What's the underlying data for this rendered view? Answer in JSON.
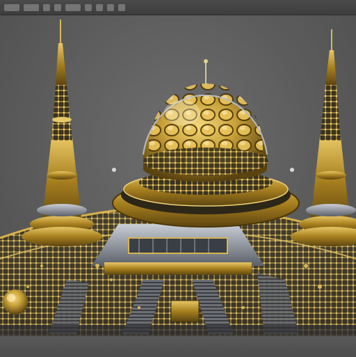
{
  "toolbar": {
    "icons": [
      "file-icon",
      "edit-icon",
      "view-icon",
      "render-icon",
      "grid-icon",
      "move-icon",
      "rotate-icon",
      "scale-icon",
      "camera-icon"
    ]
  },
  "scene": {
    "subject": "ornate-golden-palace-render",
    "colors": {
      "background": "#5e5e5e",
      "gold": "#c9a23a",
      "gold_dark": "#6e5214",
      "silver": "#a8adb5",
      "shadow": "#2b2b2b"
    }
  }
}
